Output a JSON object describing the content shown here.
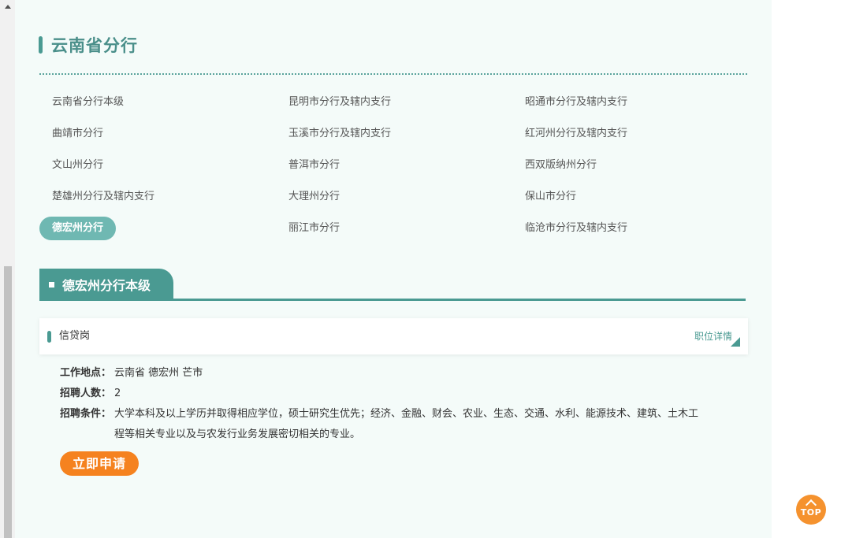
{
  "section": {
    "title": "云南省分行"
  },
  "branches": [
    {
      "label": "云南省分行本级"
    },
    {
      "label": "昆明市分行及辖内支行"
    },
    {
      "label": "昭通市分行及辖内支行"
    },
    {
      "label": "曲靖市分行"
    },
    {
      "label": "玉溪市分行及辖内支行"
    },
    {
      "label": "红河州分行及辖内支行"
    },
    {
      "label": "文山州分行"
    },
    {
      "label": "普洱市分行"
    },
    {
      "label": "西双版纳州分行"
    },
    {
      "label": "楚雄州分行及辖内支行"
    },
    {
      "label": "大理州分行"
    },
    {
      "label": "保山市分行"
    },
    {
      "label": "德宏州分行",
      "active": true
    },
    {
      "label": "丽江市分行"
    },
    {
      "label": "临沧市分行及辖内支行"
    }
  ],
  "sub_section": {
    "title": "德宏州分行本级"
  },
  "job": {
    "title": "信贷岗",
    "detail_link": "职位详情",
    "location_label": "工作地点：",
    "location": "云南省 德宏州 芒市",
    "headcount_label": "招聘人数：",
    "headcount": "2",
    "requirements_label": "招聘条件：",
    "requirements": "大学本科及以上学历并取得相应学位，硕士研究生优先；经济、金融、财会、农业、生态、交通、水利、能源技术、建筑、土木工程等相关专业以及与农发行业务发展密切相关的专业。",
    "apply_label": "立即申请"
  },
  "back_to_top": {
    "label": "TOP"
  },
  "colors": {
    "accent": "#4a9a92",
    "active_pill": "#6fb8b2",
    "apply": "#f5821f",
    "panel_bg": "#f4fbf9"
  }
}
